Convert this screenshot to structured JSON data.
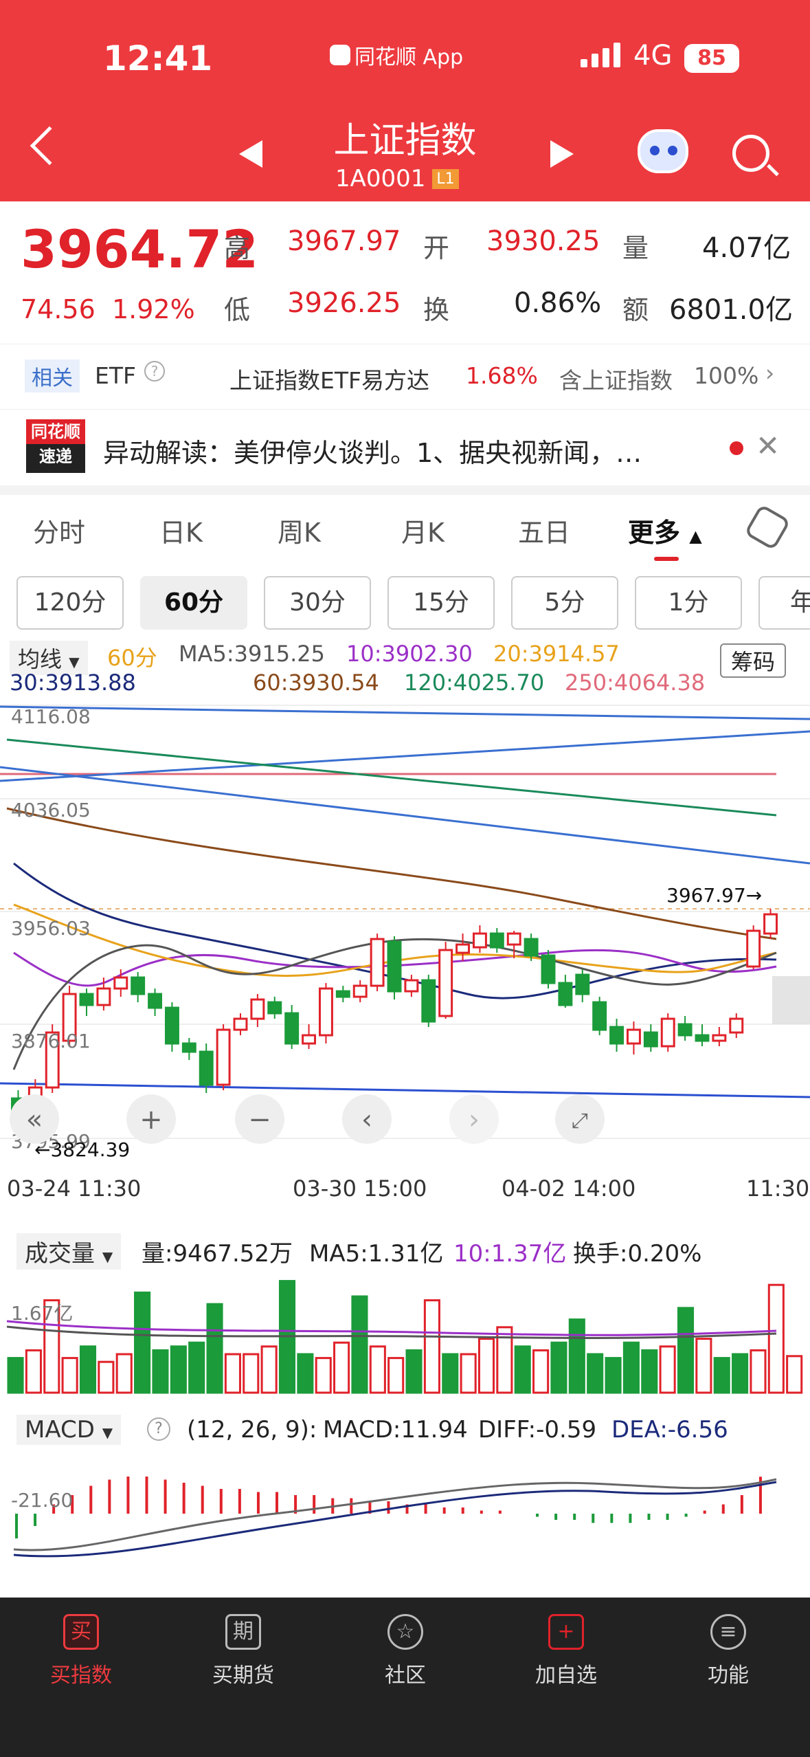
{
  "status": {
    "time": "12:41",
    "app": "同花顺 App",
    "network": "4G",
    "battery": "85"
  },
  "header": {
    "title": "上证指数",
    "code": "1A0001",
    "level": "L1"
  },
  "quote": {
    "price": "3964.72",
    "change": "74.56",
    "pct": "1.92%",
    "high_label": "高",
    "high": "3967.97",
    "open_label": "开",
    "open": "3930.25",
    "vol_label": "量",
    "vol": "4.07亿",
    "low_label": "低",
    "low": "3926.25",
    "turn_label": "换",
    "turn": "0.86%",
    "amt_label": "额",
    "amt": "6801.0亿"
  },
  "etf": {
    "tag": "相关",
    "name": "ETF",
    "fund": "上证指数ETF易方达",
    "fund_pct": "1.68%",
    "holding": "含上证指数",
    "holding_pct": "100%"
  },
  "news": {
    "logo_top": "同花顺",
    "logo_bottom": "速递",
    "text": "异动解读：美伊停火谈判。1、据央视新闻，…"
  },
  "tabs": [
    "分时",
    "日K",
    "周K",
    "月K",
    "五日",
    "更多"
  ],
  "periods": [
    "120分",
    "60分",
    "30分",
    "15分",
    "5分",
    "1分",
    "年"
  ],
  "ma": {
    "type": "均线",
    "period": "60分",
    "ma5": "MA5:3915.25",
    "m10": "10:3902.30",
    "m20": "20:3914.57",
    "m30": "30:3913.88",
    "m60": "60:3930.54",
    "m120": "120:4025.70",
    "m250": "250:4064.38",
    "chip": "筹码"
  },
  "axis": {
    "y1": "4116.08",
    "y2": "4036.05",
    "y3": "3956.03",
    "y4": "3876.01",
    "y5": "3795.99",
    "hi_mark": "3967.97→",
    "lo_mark": "←3824.39",
    "t1": "03-24 11:30",
    "t2": "03-30 15:00",
    "t3": "04-02 14:00",
    "t4": "11:30"
  },
  "volume": {
    "label": "成交量",
    "vol": "量:9467.52万",
    "ma5": "MA5:1.31亿",
    "ma10": "10:1.37亿",
    "turn": "换手:0.20%",
    "axis": "1.67亿"
  },
  "macd": {
    "label": "MACD",
    "params": "(12, 26, 9):",
    "macd": "MACD:11.94",
    "diff": "DIFF:-0.59",
    "dea": "DEA:-6.56",
    "axis": "-21.60"
  },
  "nav": [
    "买指数",
    "买期货",
    "社区",
    "加自选",
    "功能"
  ],
  "colors": {
    "brand": "#ed3a3f",
    "up": "#e0222a",
    "down": "#1b9b3a"
  },
  "chart_data": {
    "type": "candlestick",
    "candles": [
      [
        3830,
        3822,
        3836,
        3818
      ],
      [
        3824,
        3838,
        3844,
        3820
      ],
      [
        3838,
        3878,
        3884,
        3834
      ],
      [
        3872,
        3906,
        3912,
        3868
      ],
      [
        3906,
        3898,
        3910,
        3890
      ],
      [
        3898,
        3910,
        3918,
        3894
      ],
      [
        3910,
        3918,
        3924,
        3904
      ],
      [
        3918,
        3906,
        3922,
        3900
      ],
      [
        3906,
        3896,
        3910,
        3890
      ],
      [
        3896,
        3870,
        3900,
        3864
      ],
      [
        3870,
        3864,
        3874,
        3858
      ],
      [
        3864,
        3840,
        3870,
        3834
      ],
      [
        3840,
        3880,
        3884,
        3836
      ],
      [
        3880,
        3888,
        3892,
        3876
      ],
      [
        3888,
        3902,
        3906,
        3882
      ],
      [
        3900,
        3892,
        3904,
        3888
      ],
      [
        3892,
        3870,
        3898,
        3866
      ],
      [
        3870,
        3876,
        3884,
        3866
      ],
      [
        3876,
        3910,
        3914,
        3870
      ],
      [
        3908,
        3904,
        3912,
        3900
      ],
      [
        3904,
        3912,
        3916,
        3900
      ],
      [
        3912,
        3946,
        3950,
        3908
      ],
      [
        3944,
        3908,
        3948,
        3902
      ],
      [
        3908,
        3916,
        3920,
        3904
      ],
      [
        3916,
        3886,
        3920,
        3882
      ],
      [
        3890,
        3938,
        3944,
        3888
      ],
      [
        3936,
        3942,
        3950,
        3930
      ],
      [
        3940,
        3950,
        3956,
        3936
      ],
      [
        3950,
        3940,
        3954,
        3936
      ],
      [
        3942,
        3950,
        3952,
        3932
      ],
      [
        3946,
        3934,
        3950,
        3930
      ],
      [
        3934,
        3914,
        3938,
        3910
      ],
      [
        3914,
        3898,
        3920,
        3896
      ],
      [
        3920,
        3906,
        3924,
        3900
      ],
      [
        3900,
        3880,
        3904,
        3876
      ],
      [
        3882,
        3870,
        3888,
        3864
      ],
      [
        3870,
        3880,
        3886,
        3862
      ],
      [
        3878,
        3868,
        3884,
        3864
      ],
      [
        3868,
        3888,
        3892,
        3864
      ],
      [
        3884,
        3876,
        3890,
        3872
      ],
      [
        3876,
        3872,
        3884,
        3868
      ],
      [
        3872,
        3876,
        3882,
        3868
      ],
      [
        3878,
        3888,
        3892,
        3874
      ],
      [
        3926,
        3952,
        3956,
        3924
      ],
      [
        3950,
        3964,
        3968,
        3946
      ]
    ],
    "ylim": [
      3795.99,
      4116.08
    ],
    "volumes": [
      0.9,
      1.1,
      2.4,
      0.9,
      1.2,
      0.8,
      1.0,
      2.6,
      1.1,
      1.2,
      1.3,
      2.3,
      1.0,
      1.0,
      1.2,
      2.9,
      1.0,
      0.9,
      1.3,
      2.5,
      1.2,
      0.9,
      1.1,
      2.4,
      1.0,
      1.0,
      1.4,
      1.7,
      1.2,
      1.1,
      1.3,
      1.9,
      1.0,
      0.9,
      1.3,
      1.1,
      1.2,
      2.2,
      1.4,
      0.9,
      1.0,
      1.1,
      2.8,
      0.95
    ],
    "macd_hist": [
      -8,
      -4,
      3,
      6,
      9,
      11,
      12,
      12,
      11,
      10,
      9,
      8,
      8,
      7,
      7,
      6,
      6,
      5,
      5,
      4,
      4,
      3,
      3,
      2,
      2,
      1,
      1,
      0,
      -1,
      -2,
      -2,
      -3,
      -3,
      -3,
      -2,
      -2,
      -1,
      1,
      3,
      6,
      11.94
    ]
  }
}
